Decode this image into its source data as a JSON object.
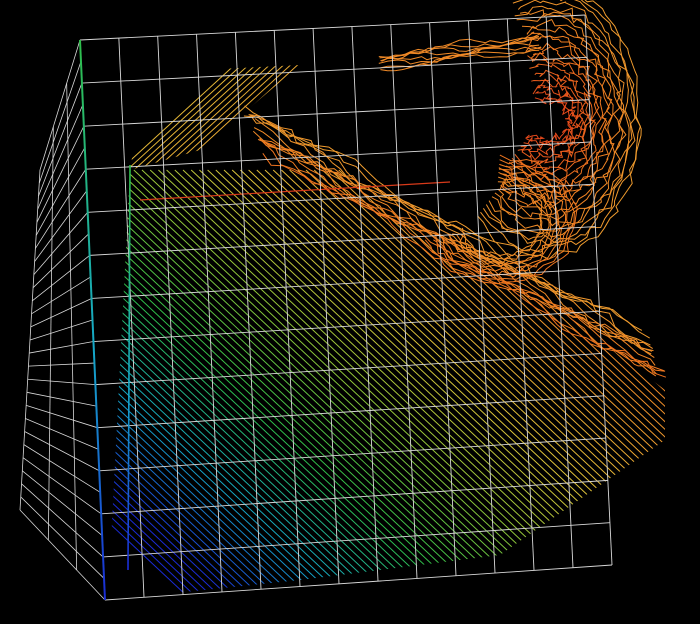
{
  "viewport": {
    "background": "#000000",
    "grid_color": "#d8d8d8"
  },
  "surface": {
    "colormap": [
      "#1a2bd6",
      "#15a8c8",
      "#2fbf4a",
      "#8cc63a",
      "#e0c53a",
      "#f0a030",
      "#f07a20",
      "#e0401a"
    ],
    "cut_line_color": "#d83a1a"
  }
}
